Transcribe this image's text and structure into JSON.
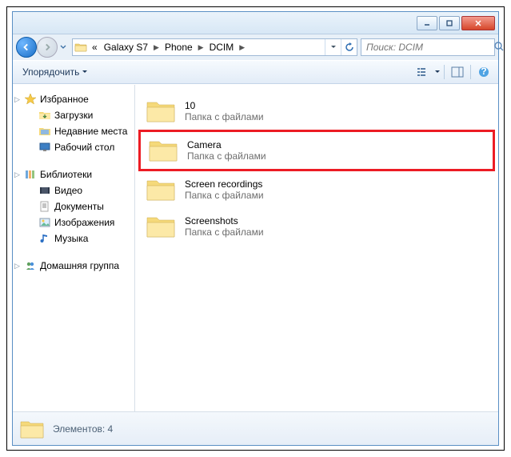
{
  "titlebar": {},
  "nav": {
    "breadcrumbs": [
      "«",
      "Galaxy S7",
      "Phone",
      "DCIM"
    ],
    "search_placeholder": "Поиск: DCIM"
  },
  "toolbar": {
    "organize": "Упорядочить"
  },
  "sidebar": {
    "favorites": {
      "header": "Избранное",
      "items": [
        "Загрузки",
        "Недавние места",
        "Рабочий стол"
      ]
    },
    "libraries": {
      "header": "Библиотеки",
      "items": [
        "Видео",
        "Документы",
        "Изображения",
        "Музыка"
      ]
    },
    "homegroup": {
      "header": "Домашняя группа"
    }
  },
  "content": {
    "type_label": "Папка с файлами",
    "items": [
      {
        "name": "10",
        "highlight": false
      },
      {
        "name": "Camera",
        "highlight": true
      },
      {
        "name": "Screen recordings",
        "highlight": false
      },
      {
        "name": "Screenshots",
        "highlight": false
      }
    ]
  },
  "status": {
    "text": "Элементов: 4"
  }
}
